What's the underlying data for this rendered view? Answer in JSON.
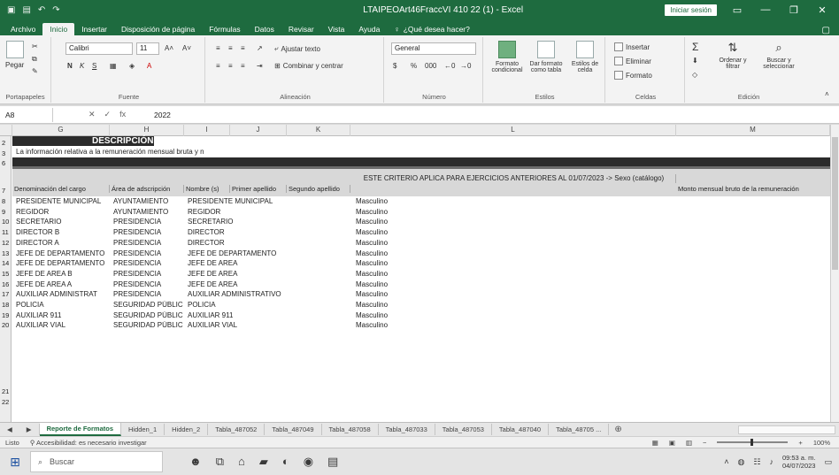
{
  "window": {
    "title": "LTAIPEOArt46FraccVI 410 22 (1) - Excel",
    "signin": "Iniciar sesión",
    "min": "—",
    "restore": "❐",
    "close": "✕"
  },
  "tabs": [
    "Archivo",
    "Inicio",
    "Insertar",
    "Disposición de página",
    "Fórmulas",
    "Datos",
    "Revisar",
    "Vista",
    "Ayuda"
  ],
  "tellme": "¿Qué desea hacer?",
  "ribbon": {
    "clipboard": {
      "paste": "Pegar",
      "label": "Portapapeles"
    },
    "font": {
      "name": "Calibri",
      "size": "11",
      "bold": "N",
      "italic": "K",
      "underline": "S",
      "label": "Fuente"
    },
    "alignment": {
      "wrap": "Ajustar texto",
      "merge": "Combinar y centrar",
      "label": "Alineación"
    },
    "number": {
      "format": "General",
      "currency": "$",
      "percent": "%",
      "thousands": "000",
      "label": "Número"
    },
    "styles": {
      "conditional": "Formato condicional",
      "as_table": "Dar formato como tabla",
      "cell_styles": "Estilos de celda",
      "label": "Estilos"
    },
    "cells": {
      "insert": "Insertar",
      "delete": "Eliminar",
      "format": "Formato",
      "label": "Celdas"
    },
    "editing": {
      "sort": "Ordenar y filtrar",
      "find": "Buscar y seleccionar",
      "label": "Edición"
    }
  },
  "formula_bar": {
    "name_box": "A8",
    "fx": "fx",
    "value": "2022"
  },
  "columns": [
    "G",
    "H",
    "I",
    "J",
    "K",
    "L",
    "M"
  ],
  "sheet": {
    "description": "DESCRIPCIÓN",
    "info_text": "La información relativa a la remuneración mensual bruta y n",
    "headers": {
      "g": "Denominación del cargo",
      "h": "Área de adscripción",
      "i": "Nombre (s)",
      "j": "Primer apellido",
      "k": "Segundo apellido",
      "l": "ESTE CRITERIO APLICA PARA EJERCICIOS ANTERIORES AL 01/07/2023 -> Sexo (catálogo)",
      "m": "Monto mensual bruto de la remuneración"
    },
    "row_numbers": [
      "2",
      "3",
      "6",
      "7",
      "8",
      "9",
      "10",
      "11",
      "12",
      "13",
      "14",
      "15",
      "16",
      "17",
      "18",
      "19",
      "20",
      "21",
      "22"
    ],
    "rows": [
      {
        "n": "8",
        "cargo": "PRESIDENTE MUNICIPAL",
        "area": "AYUNTAMIENTO",
        "nombre": "PRESIDENTE MUNICIPAL",
        "sexo": "Masculino"
      },
      {
        "n": "9",
        "cargo": "REGIDOR",
        "area": "AYUNTAMIENTO",
        "nombre": "REGIDOR",
        "sexo": "Masculino"
      },
      {
        "n": "10",
        "cargo": "SECRETARIO",
        "area": "PRESIDENCIA",
        "nombre": "SECRETARIO",
        "sexo": "Masculino"
      },
      {
        "n": "11",
        "cargo": "DIRECTOR B",
        "area": "PRESIDENCIA",
        "nombre": "DIRECTOR",
        "sexo": "Masculino"
      },
      {
        "n": "12",
        "cargo": "DIRECTOR A",
        "area": "PRESIDENCIA",
        "nombre": "DIRECTOR",
        "sexo": "Masculino"
      },
      {
        "n": "13",
        "cargo": "JEFE DE DEPARTAMENTO",
        "area": "PRESIDENCIA",
        "nombre": "JEFE DE DEPARTAMENTO",
        "sexo": "Masculino"
      },
      {
        "n": "14",
        "cargo": "JEFE DE DEPARTAMENTO",
        "area": "PRESIDENCIA",
        "nombre": "JEFE DE AREA",
        "sexo": "Masculino"
      },
      {
        "n": "15",
        "cargo": "JEFE DE AREA B",
        "area": "PRESIDENCIA",
        "nombre": "JEFE DE AREA",
        "sexo": "Masculino"
      },
      {
        "n": "16",
        "cargo": "JEFE DE AREA A",
        "area": "PRESIDENCIA",
        "nombre": "JEFE DE AREA",
        "sexo": "Masculino"
      },
      {
        "n": "17",
        "cargo": "AUXILIAR ADMINISTRAT",
        "area": "PRESIDENCIA",
        "nombre": "AUXILIAR ADMINISTRATIVO",
        "sexo": "Masculino"
      },
      {
        "n": "18",
        "cargo": "POLICIA",
        "area": "SEGURIDAD PÚBLIC",
        "nombre": "POLICIA",
        "sexo": "Masculino"
      },
      {
        "n": "19",
        "cargo": "AUXILIAR 911",
        "area": "SEGURIDAD PÚBLIC",
        "nombre": "AUXILIAR 911",
        "sexo": "Masculino"
      },
      {
        "n": "20",
        "cargo": "AUXILIAR VIAL",
        "area": "SEGURIDAD PÚBLIC",
        "nombre": "AUXILIAR VIAL",
        "sexo": "Masculino"
      }
    ]
  },
  "sheet_tabs": [
    "Reporte de Formatos",
    "Hidden_1",
    "Hidden_2",
    "Tabla_487052",
    "Tabla_487049",
    "Tabla_487058",
    "Tabla_487033",
    "Tabla_487053",
    "Tabla_487040",
    "Tabla_48705 ..."
  ],
  "status": {
    "mode": "Listo",
    "accessibility": "Accesibilidad: es necesario investigar",
    "zoom": "100%"
  },
  "taskbar": {
    "search": "Buscar",
    "time": "09:53 a. m.",
    "date": "04/07/2023"
  }
}
